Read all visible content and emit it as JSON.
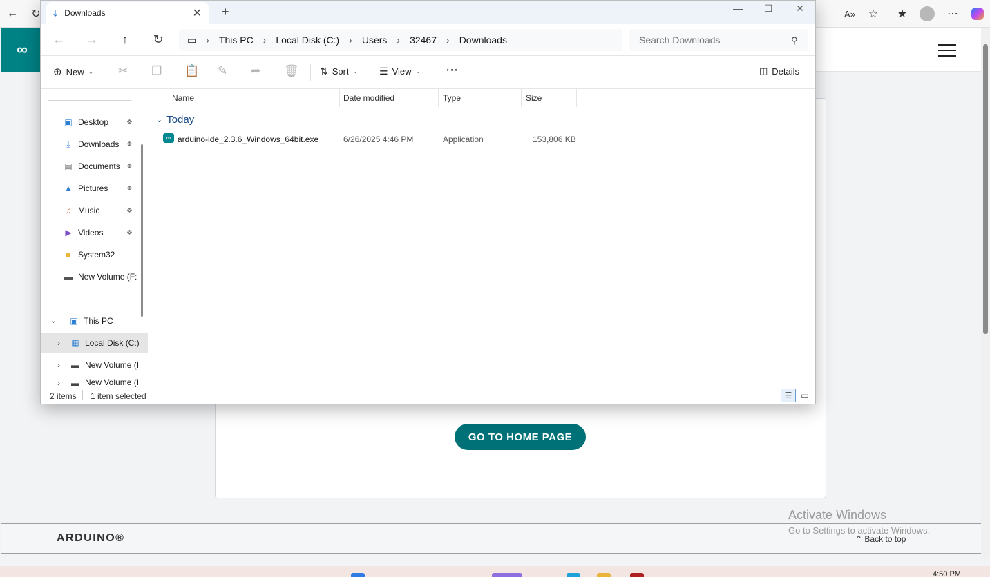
{
  "browser": {
    "icons": [
      "back-icon",
      "refresh-icon",
      "read-aloud-icon",
      "favorite-star-icon",
      "favorites-icon",
      "profile-avatar",
      "more-icon",
      "copilot-icon"
    ],
    "read_aloud_glyph": "A»"
  },
  "explorer": {
    "tab_title": "Downloads",
    "breadcrumb": [
      "This PC",
      "Local Disk (C:)",
      "Users",
      "32467",
      "Downloads"
    ],
    "search_placeholder": "Search Downloads",
    "toolbar": {
      "new_label": "New",
      "sort_label": "Sort",
      "view_label": "View",
      "details_label": "Details"
    },
    "nav": {
      "quick_access": [
        {
          "label": "Desktop",
          "icon": "desktop-icon",
          "pinned": true
        },
        {
          "label": "Downloads",
          "icon": "download-icon",
          "pinned": true
        },
        {
          "label": "Documents",
          "icon": "documents-icon",
          "pinned": true
        },
        {
          "label": "Pictures",
          "icon": "pictures-icon",
          "pinned": true
        },
        {
          "label": "Music",
          "icon": "music-icon",
          "pinned": true
        },
        {
          "label": "Videos",
          "icon": "videos-icon",
          "pinned": true
        },
        {
          "label": "System32",
          "icon": "folder-icon",
          "pinned": false
        },
        {
          "label": "New Volume (F:",
          "icon": "drive-icon",
          "pinned": false
        }
      ],
      "this_pc": "This PC",
      "drives": [
        "Local Disk (C:)",
        "New Volume (I",
        "New Volume (I"
      ]
    },
    "columns": [
      "Name",
      "Date modified",
      "Type",
      "Size"
    ],
    "group_label": "Today",
    "files": [
      {
        "name": "arduino-ide_2.3.6_Windows_64bit.exe",
        "date": "6/26/2025 4:46 PM",
        "type": "Application",
        "size": "153,806 KB"
      }
    ],
    "status": {
      "items": "2 items",
      "selected": "1 item selected"
    }
  },
  "arduino_page": {
    "home_button": "GO TO HOME PAGE",
    "footer_logo": "ARDUINO®",
    "back_to_top": "Back to top",
    "brand_color": "#008184"
  },
  "watermark": {
    "line1": "Activate Windows",
    "line2": "Go to Settings to activate Windows."
  },
  "taskbar": {
    "time": "4:50 PM"
  }
}
